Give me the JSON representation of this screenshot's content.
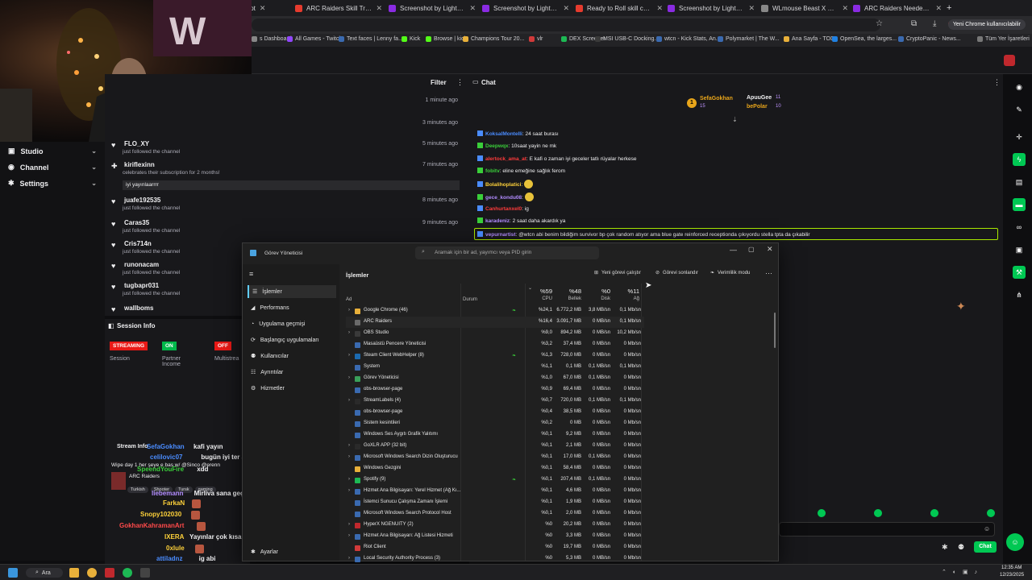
{
  "browser": {
    "tabs": [
      {
        "label": "lshot",
        "color": "#8a2be2"
      },
      {
        "label": "ARC Raiders Skill Tree Builder",
        "color": "#e63b2e"
      },
      {
        "label": "Screenshot by Lightshot",
        "color": "#8a2be2"
      },
      {
        "label": "Screenshot by Lightshot",
        "color": "#8a2be2"
      },
      {
        "label": "Ready to Roll skill could pote",
        "color": "#e63b2e"
      },
      {
        "label": "Screenshot by Lightshot",
        "color": "#8a2be2"
      },
      {
        "label": "WLmouse Beast X Pro [BBL Ed",
        "color": "#888888"
      },
      {
        "label": "ARC Raiders Needed Items |",
        "color": "#8a2be2"
      }
    ],
    "new_tab": "+",
    "user_badge": "Yeni Chrome kullanıcılabilir",
    "bookmarks": [
      "s Dashboard",
      "All Games - Twitch",
      "Text faces | Lenny fa...",
      "Kick",
      "Browse | kick",
      "Champions Tour 20...",
      "vlr",
      "DEX Screener",
      "MSI USB-C Docking...",
      "wtcn - Kick Stats, An...",
      "Polymarket | The W...",
      "Ana Sayfa - TOD",
      "OpenSea, the larges...",
      "CryptoPanic - News...",
      "Tüm Yer İşaretleri"
    ]
  },
  "leftnav": {
    "items": [
      {
        "label": "Studio",
        "icon": "camera-icon"
      },
      {
        "label": "Channel",
        "icon": "user-icon"
      },
      {
        "label": "Settings",
        "icon": "gear-icon"
      }
    ]
  },
  "activity": {
    "filter_label": "Filter",
    "events": [
      {
        "name": "",
        "desc": "",
        "time": "1 minute ago"
      },
      {
        "name": "",
        "desc": "",
        "time": "3 minutes ago"
      },
      {
        "name": "FLO_XY",
        "desc": "just followed the channel",
        "time": "5 minutes ago"
      },
      {
        "name": "kiriflexinn",
        "desc": "celebrates their subscription for 2 months!",
        "time": "7 minutes ago",
        "message": "iyi yayınlaarrrr"
      },
      {
        "name": "juafe192535",
        "desc": "just followed the channel",
        "time": "8 minutes ago"
      },
      {
        "name": "Caras35",
        "desc": "just followed the channel",
        "time": "9 minutes ago"
      },
      {
        "name": "Cris714n",
        "desc": "just followed the channel",
        "time": ""
      },
      {
        "name": "runonacam",
        "desc": "just followed the channel",
        "time": ""
      },
      {
        "name": "tugbapr031",
        "desc": "just followed the channel",
        "time": ""
      },
      {
        "name": "wallboms",
        "desc": "",
        "time": ""
      }
    ]
  },
  "session": {
    "title": "Session Info",
    "streaming": "STREAMING",
    "on": "ON",
    "off": "OFF",
    "session_label": "Session",
    "partner_label": "Partner Income",
    "multistream_label": "Multistrea"
  },
  "streaminfo": {
    "title": "Stream Info",
    "stream_title": "Wipe day 1 her şeye e bas w/ @Sinco @erenn",
    "game": "ARC Raiders",
    "tags": [
      "Turkish",
      "Shooter",
      "Tursk",
      "gaming"
    ]
  },
  "overlay_chat": [
    {
      "user": "SefaGokhan",
      "text": "kafi yayın",
      "color": "#4a8cff"
    },
    {
      "user": "celilovic07",
      "text": "bugün iyi ter attık beyler yarın yine aynı fero",
      "color": "#4a8cff"
    },
    {
      "user": "SpeendYouFire",
      "text": "xdd",
      "color": "#3acf3a"
    },
    {
      "user": "liebemann",
      "text": "Mirliva sana geçek",
      "color": "#b28cff"
    },
    {
      "user": "FarkaN",
      "text": "",
      "color": "#ffd23a"
    },
    {
      "user": "Snopy102030",
      "text": "",
      "color": "#ffd23a"
    },
    {
      "user": "GokhanKahramanArt",
      "text": "",
      "color": "#ff4a4a"
    },
    {
      "user": "IXERA",
      "text": "Yayınlar çok kısa @wtcn",
      "color": "#ffd23a"
    },
    {
      "user": "0xlule",
      "text": "",
      "color": "#ffd23a"
    },
    {
      "user": "attiladnz",
      "text": "ig abi",
      "color": "#4a8cff"
    },
    {
      "user": "Sevdha",
      "text": "Eline sağlık",
      "color": "#b28cff"
    }
  ],
  "chat": {
    "title": "Chat",
    "leaderboard": [
      {
        "name": "SefaGokhan",
        "count": "15"
      },
      {
        "name": "ApuuGee",
        "count": "11"
      },
      {
        "name": "bePolar",
        "count": "10"
      }
    ],
    "messages": [
      {
        "user": "KoksalMontelli",
        "text": "24 saat burası",
        "color": "#4a8cff"
      },
      {
        "user": "Deepwqx",
        "text": "10saat yayin ne mk",
        "color": "#3acf3a"
      },
      {
        "user": "alertock_ama_at",
        "text": "E kafi o zaman iyi geceler tatlı rüyalar herkese",
        "color": "#ff3b3b"
      },
      {
        "user": "fobitv",
        "text": "eline emeğine sağlık ferom",
        "color": "#3acf3a"
      },
      {
        "user": "Bolalihoplatici",
        "text": "",
        "color": "#ffd23a"
      },
      {
        "user": "gece_kondu08",
        "text": "",
        "color": "#b28cff"
      },
      {
        "user": "Canhurtanxel0",
        "text": "ig",
        "color": "#ff3b3b"
      },
      {
        "user": "karadeniz",
        "text": "2 saat daha akardık ya",
        "color": "#b28cff"
      },
      {
        "user": "vepurnartist",
        "text": "@wtcn abi benim bildiğim survivor bp çok random atıyor ama blue gate reinforced receptionda çıkıyordu stella tpta da çıkabilir",
        "color": "#b28cff"
      }
    ],
    "chat_button": "Chat"
  },
  "taskmanager": {
    "title": "Görev Yöneticisi",
    "search_placeholder": "Aramak için bir ad, yayımcı veya PID girin",
    "page_title": "İşlemler",
    "run_new": "Yeni görevi çalıştır",
    "end_task": "Görevi sonlandır",
    "efficiency": "Verimlilik modu",
    "nav": [
      "İşlemler",
      "Performans",
      "Uygulama geçmişi",
      "Başlangıç uygulamaları",
      "Kullanıcılar",
      "Ayrıntılar",
      "Hizmetler"
    ],
    "settings": "Ayarlar",
    "columns": {
      "name": "Ad",
      "status": "Durum",
      "cpu_pct": "%59",
      "cpu": "CPU",
      "mem_pct": "%48",
      "mem": "Bellek",
      "disk_pct": "%0",
      "disk": "Disk",
      "net_pct": "%11",
      "net": "Ağ"
    },
    "processes": [
      {
        "name": "Google Chrome (46)",
        "cpu": "%24,1",
        "mem": "6.772,2 MB",
        "disk": "3,8 MB/sn",
        "net": "0,1 Mb/sn",
        "exp": true,
        "color": "#e8b03a",
        "leaf": true
      },
      {
        "name": "ARC Raiders",
        "cpu": "%16,4",
        "mem": "3.091,7 MB",
        "disk": "0 MB/sn",
        "net": "0,1 Mb/sn",
        "exp": false,
        "color": "#6a6a6a"
      },
      {
        "name": "OBS Studio",
        "cpu": "%9,0",
        "mem": "894,2 MB",
        "disk": "0 MB/sn",
        "net": "10,2 Mb/sn",
        "exp": true,
        "color": "#3a3a3a"
      },
      {
        "name": "Masaüstü Pencere Yöneticisi",
        "cpu": "%3,2",
        "mem": "37,4 MB",
        "disk": "0 MB/sn",
        "net": "0 Mb/sn",
        "exp": false,
        "color": "#3a6ab0"
      },
      {
        "name": "Steam Client WebHelper (8)",
        "cpu": "%1,3",
        "mem": "728,0 MB",
        "disk": "0 MB/sn",
        "net": "0 Mb/sn",
        "exp": true,
        "color": "#1b6ab0",
        "leaf": true
      },
      {
        "name": "System",
        "cpu": "%1,1",
        "mem": "0,1 MB",
        "disk": "0,1 MB/sn",
        "net": "0,1 Mb/sn",
        "exp": false,
        "color": "#3a6ab0"
      },
      {
        "name": "Görev Yöneticisi",
        "cpu": "%1,0",
        "mem": "67,0 MB",
        "disk": "0,1 MB/sn",
        "net": "0 Mb/sn",
        "exp": true,
        "color": "#3aa05a"
      },
      {
        "name": "obs-browser-page",
        "cpu": "%0,9",
        "mem": "69,4 MB",
        "disk": "0 MB/sn",
        "net": "0 Mb/sn",
        "exp": false,
        "color": "#3a6ab0"
      },
      {
        "name": "StreamLabels (4)",
        "cpu": "%0,7",
        "mem": "720,0 MB",
        "disk": "0,1 MB/sn",
        "net": "0,1 Mb/sn",
        "exp": true,
        "color": "#2a2a2a"
      },
      {
        "name": "obs-browser-page",
        "cpu": "%0,4",
        "mem": "38,5 MB",
        "disk": "0 MB/sn",
        "net": "0 Mb/sn",
        "exp": false,
        "color": "#3a6ab0"
      },
      {
        "name": "Sistem kesintileri",
        "cpu": "%0,2",
        "mem": "0 MB",
        "disk": "0 MB/sn",
        "net": "0 Mb/sn",
        "exp": false,
        "color": "#3a6ab0"
      },
      {
        "name": "Windows Ses Aygıtı Grafik Yalıtımı",
        "cpu": "%0,1",
        "mem": "9,2 MB",
        "disk": "0 MB/sn",
        "net": "0 Mb/sn",
        "exp": false,
        "color": "#3a6ab0"
      },
      {
        "name": "GoXLR APP (32 bit)",
        "cpu": "%0,1",
        "mem": "2,1 MB",
        "disk": "0 MB/sn",
        "net": "0 Mb/sn",
        "exp": true,
        "color": "#2a2a2a"
      },
      {
        "name": "Microsoft Windows Search Dizin Oluşturucu",
        "cpu": "%0,1",
        "mem": "17,0 MB",
        "disk": "0,1 MB/sn",
        "net": "0 Mb/sn",
        "exp": true,
        "color": "#3a6ab0"
      },
      {
        "name": "Windows Gezgini",
        "cpu": "%0,1",
        "mem": "58,4 MB",
        "disk": "0 MB/sn",
        "net": "0 Mb/sn",
        "exp": false,
        "color": "#e8b03a"
      },
      {
        "name": "Spotify (9)",
        "cpu": "%0,1",
        "mem": "207,4 MB",
        "disk": "0,1 MB/sn",
        "net": "0 Mb/sn",
        "exp": true,
        "color": "#1db954",
        "leaf": true
      },
      {
        "name": "Hizmet Ana Bilgisayarı: Yerel Hizmet (Ağ Kı...",
        "cpu": "%0,1",
        "mem": "4,6 MB",
        "disk": "0 MB/sn",
        "net": "0 Mb/sn",
        "exp": true,
        "color": "#3a6ab0"
      },
      {
        "name": "İstemci Sunucu Çalışma Zamanı İşlemi",
        "cpu": "%0,1",
        "mem": "1,9 MB",
        "disk": "0 MB/sn",
        "net": "0 Mb/sn",
        "exp": false,
        "color": "#3a6ab0"
      },
      {
        "name": "Microsoft Windows Search Protocol Host",
        "cpu": "%0,1",
        "mem": "2,0 MB",
        "disk": "0 MB/sn",
        "net": "0 Mb/sn",
        "exp": false,
        "color": "#3a6ab0"
      },
      {
        "name": "HyperX NGENUITY (2)",
        "cpu": "%0",
        "mem": "20,2 MB",
        "disk": "0 MB/sn",
        "net": "0 Mb/sn",
        "exp": true,
        "color": "#c0282d"
      },
      {
        "name": "Hizmet Ana Bilgisayarı: Ağ Listesi Hizmeti",
        "cpu": "%0",
        "mem": "3,3 MB",
        "disk": "0 MB/sn",
        "net": "0 Mb/sn",
        "exp": true,
        "color": "#3a6ab0"
      },
      {
        "name": "Riot Client",
        "cpu": "%0",
        "mem": "19,7 MB",
        "disk": "0 MB/sn",
        "net": "0 Mb/sn",
        "exp": false,
        "color": "#d13a3a"
      },
      {
        "name": "Local Security Authority Process (3)",
        "cpu": "%0",
        "mem": "5,3 MB",
        "disk": "0 MB/sn",
        "net": "0 Mb/sn",
        "exp": true,
        "color": "#3a6ab0"
      }
    ]
  },
  "taskbar": {
    "search": "Ara",
    "time": "12:35 AM",
    "date": "12/23/2025"
  }
}
